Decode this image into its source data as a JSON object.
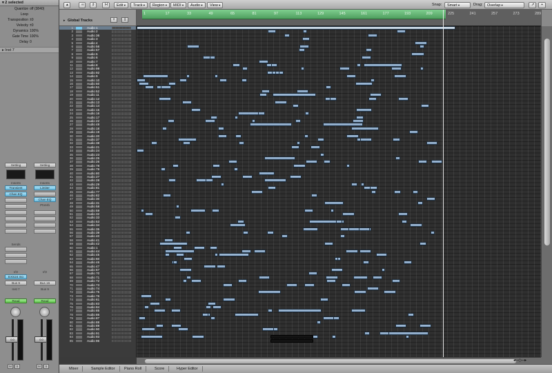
{
  "inspector": {
    "header": "2 selected",
    "params": [
      {
        "label": "Quantize",
        "value": "off (3840)"
      },
      {
        "label": "Loop",
        "value": ""
      },
      {
        "label": "Transposition",
        "value": "±0"
      },
      {
        "label": "Velocity",
        "value": "±0"
      },
      {
        "label": "Dynamics",
        "value": "100%"
      },
      {
        "label": "Gate Time",
        "value": "100%"
      },
      {
        "label": "Delay",
        "value": "0"
      }
    ],
    "subheader": "Inst 7",
    "strip1": {
      "setting": "Setting",
      "inserts_label": "Inserts",
      "insert1": "Transient",
      "insert2": "Chan EQ",
      "sends_label": "Sends",
      "io_label": "I/O",
      "input": "EXS24 mo",
      "output": "Bus 9",
      "mode": "Read",
      "name": "Inst 7",
      "fader_value": "0.0",
      "mute": "M",
      "solo": "S"
    },
    "strip2": {
      "setting": "Setting",
      "inserts_label": "Inserts",
      "insert1": "Limiter",
      "insert2": "Chan EQ",
      "insert3": "PtVerb",
      "io_label": "I/O",
      "output": "Bus 16",
      "mode": "Read",
      "name": "Bus 9",
      "fader_value": "0.0",
      "mute": "M",
      "solo": "S"
    }
  },
  "toolbar": {
    "edit": "Edit",
    "track": "Track",
    "region": "Region",
    "midi": "MIDI",
    "audio": "Audio",
    "view": "View",
    "snap_label": "Snap:",
    "snap_value": "Smart",
    "drag_label": "Drag:",
    "drag_value": "Overlap",
    "h_button": "H"
  },
  "global_tracks": {
    "label": "Global Tracks"
  },
  "ruler": {
    "ticks": [
      "1",
      "17",
      "33",
      "49",
      "65",
      "81",
      "97",
      "113",
      "129",
      "145",
      "161",
      "177",
      "193",
      "209",
      "225",
      "241",
      "257",
      "273",
      "289"
    ]
  },
  "tracks": [
    {
      "num": "1",
      "name": "Audio 1"
    },
    {
      "num": "2",
      "name": "Audio 2"
    },
    {
      "num": "3",
      "name": "Audio 36"
    },
    {
      "num": "4",
      "name": "Audio 3"
    },
    {
      "num": "5",
      "name": "Audio 4"
    },
    {
      "num": "6",
      "name": "Audio 56"
    },
    {
      "num": "7",
      "name": "Audio 57"
    },
    {
      "num": "8",
      "name": "Audio 5"
    },
    {
      "num": "9",
      "name": "Audio 6"
    },
    {
      "num": "10",
      "name": "Audio 7"
    },
    {
      "num": "11",
      "name": "Audio 8"
    },
    {
      "num": "12",
      "name": "Audio 99"
    },
    {
      "num": "13",
      "name": "Audio 92"
    },
    {
      "num": "14",
      "name": "Audio 9"
    },
    {
      "num": "15",
      "name": "Audio 10"
    },
    {
      "num": "16",
      "name": "Audio 50"
    },
    {
      "num": "17",
      "name": "Audio 51"
    },
    {
      "num": "18",
      "name": "Audio 52"
    },
    {
      "num": "19",
      "name": "Audio 11"
    },
    {
      "num": "20",
      "name": "Audio 12"
    },
    {
      "num": "21",
      "name": "Audio 13"
    },
    {
      "num": "22",
      "name": "Audio 14"
    },
    {
      "num": "23",
      "name": "Audio 15"
    },
    {
      "num": "24",
      "name": "Audio 16"
    },
    {
      "num": "25",
      "name": "Audio 17"
    },
    {
      "num": "26",
      "name": "Audio 22"
    },
    {
      "num": "27",
      "name": "Audio 48"
    },
    {
      "num": "28",
      "name": "Audio 18"
    },
    {
      "num": "29",
      "name": "Audio 19"
    },
    {
      "num": "30",
      "name": "Audio 20"
    },
    {
      "num": "31",
      "name": "Audio 37"
    },
    {
      "num": "32",
      "name": "Audio 38"
    },
    {
      "num": "33",
      "name": "Audio 21"
    },
    {
      "num": "34",
      "name": "Audio 24"
    },
    {
      "num": "35",
      "name": "Audio 23"
    },
    {
      "num": "36",
      "name": "Audio 25"
    },
    {
      "num": "37",
      "name": "Audio 26"
    },
    {
      "num": "38",
      "name": "Audio 78"
    },
    {
      "num": "39",
      "name": "Audio 79"
    },
    {
      "num": "40",
      "name": "Audio 80"
    },
    {
      "num": "41",
      "name": "Audio 27"
    },
    {
      "num": "42",
      "name": "Audio 28"
    },
    {
      "num": "43",
      "name": "Audio 29"
    },
    {
      "num": "44",
      "name": "Audio 81"
    },
    {
      "num": "45",
      "name": "Audio 77"
    },
    {
      "num": "46",
      "name": "Audio 82"
    },
    {
      "num": "47",
      "name": "Audio 30"
    },
    {
      "num": "48",
      "name": "Audio 31"
    },
    {
      "num": "49",
      "name": "Audio 58"
    },
    {
      "num": "50",
      "name": "Audio 59"
    },
    {
      "num": "51",
      "name": "Audio 32"
    },
    {
      "num": "52",
      "name": "Audio 33"
    },
    {
      "num": "53",
      "name": "Audio 53"
    },
    {
      "num": "54",
      "name": "Audio 34"
    },
    {
      "num": "55",
      "name": "Audio 35"
    },
    {
      "num": "56",
      "name": "Audio 39"
    },
    {
      "num": "57",
      "name": "Audio 40"
    },
    {
      "num": "58",
      "name": "Audio 41"
    },
    {
      "num": "59",
      "name": "Audio 42"
    },
    {
      "num": "60",
      "name": "Audio 1"
    },
    {
      "num": "61",
      "name": "Audio 44"
    },
    {
      "num": "62",
      "name": "Audio 45"
    },
    {
      "num": "63",
      "name": "Audio 60"
    },
    {
      "num": "64",
      "name": "Audio 46"
    },
    {
      "num": "65",
      "name": "Audio 47"
    },
    {
      "num": "66",
      "name": "Audio 67"
    },
    {
      "num": "67",
      "name": "Audio 70"
    },
    {
      "num": "68",
      "name": "Audio 71"
    },
    {
      "num": "69",
      "name": "Audio 72"
    },
    {
      "num": "70",
      "name": "Audio 73"
    },
    {
      "num": "71",
      "name": "Audio 74"
    },
    {
      "num": "72",
      "name": "Audio 75"
    },
    {
      "num": "73",
      "name": "Audio 76"
    },
    {
      "num": "74",
      "name": "Audio 61"
    },
    {
      "num": "75",
      "name": "Audio 83"
    },
    {
      "num": "76",
      "name": "Audio 84"
    },
    {
      "num": "77",
      "name": "Audio 85"
    },
    {
      "num": "78",
      "name": "Audio 86"
    },
    {
      "num": "79",
      "name": "Audio 87"
    },
    {
      "num": "80",
      "name": "Audio 88"
    },
    {
      "num": "81",
      "name": "Audio 89"
    },
    {
      "num": "82",
      "name": "Audio 90"
    },
    {
      "num": "83",
      "name": "Audio 91"
    },
    {
      "num": "84",
      "name": "Audio 93"
    },
    {
      "num": "85",
      "name": "Audio 96"
    }
  ],
  "bottom_tabs": [
    "Mixer",
    "Sample Editor",
    "Piano Roll",
    "Score",
    "Hyper Editor"
  ],
  "icons": {
    "pointer_tool": "arrow-pointer-icon",
    "pencil_tool": "pencil-icon",
    "zoom_in": "zoom-in-icon",
    "zoom_out": "zoom-out-icon"
  },
  "colors": {
    "cycle": "#5fb36f",
    "region": "#8fb0d0",
    "selected_track": "#6c7e8f",
    "insert_blue": "#7ccbee",
    "read_green": "#6cd05a"
  }
}
